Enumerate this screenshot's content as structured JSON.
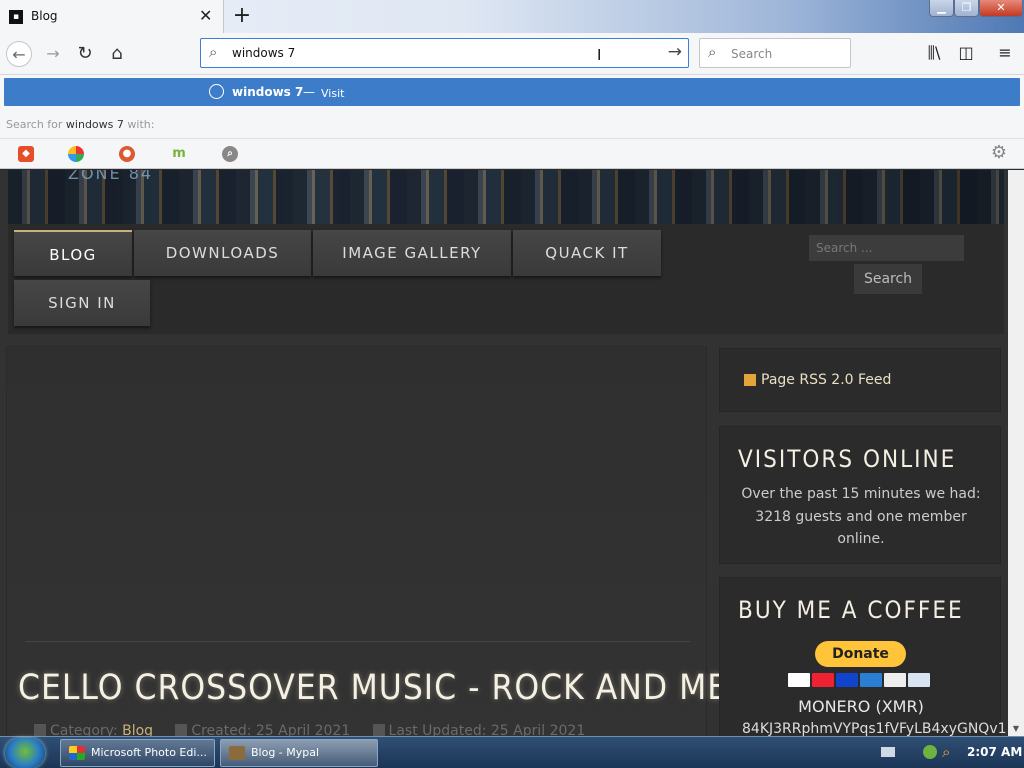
{
  "browser": {
    "tab": {
      "title": "Blog",
      "close_glyph": "✕"
    },
    "new_tab_glyph": "+",
    "window_controls": {
      "minimize": "▁",
      "maximize": "❐",
      "close": "✕"
    },
    "nav": {
      "back": "←",
      "forward": "→",
      "reload": "↻",
      "home": "⌂"
    },
    "urlbar": {
      "value": "windows 7",
      "search_icon": "⌕",
      "go_icon": "→",
      "caret": "I"
    },
    "searchbar": {
      "placeholder": "Search",
      "search_icon": "⌕"
    },
    "toolbar": {
      "library": "⫼\\",
      "sidebar": "◫",
      "menu": "≡"
    }
  },
  "urlbar_popup": {
    "suggestion": {
      "text": "windows 7",
      "dash": "—",
      "action": "Visit"
    },
    "search_for_prefix": "Search for ",
    "search_for_term": "windows 7",
    "search_for_suffix": " with:",
    "engines": [
      {
        "name": "brave-search-icon",
        "glyph": "◆"
      },
      {
        "name": "qwant-icon",
        "glyph": ""
      },
      {
        "name": "duckduckgo-icon",
        "glyph": "●"
      },
      {
        "name": "mojeek-icon",
        "glyph": "m"
      },
      {
        "name": "generic-search-icon",
        "glyph": "⌕"
      }
    ],
    "settings_glyph": "⚙"
  },
  "site": {
    "banner_logo": "ZONE 84",
    "menu": {
      "blog": "BLOG",
      "downloads": "DOWNLOADS",
      "gallery": "IMAGE GALLERY",
      "quack": "QUACK IT",
      "signin": "SIGN IN"
    },
    "search": {
      "placeholder": "Search ...",
      "button": "Search"
    },
    "article": {
      "title": "CELLO CROSSOVER MUSIC - ROCK AND METAL",
      "category_label": "Category: ",
      "category": "Blog",
      "created": "Created: 25 April 2021",
      "updated": "Last Updated: 25 April 2021"
    },
    "rss": {
      "label": "Page RSS 2.0 Feed"
    },
    "visitors": {
      "heading": "VISITORS ONLINE",
      "text": "Over the past 15 minutes we had: 3218 guests and one member online."
    },
    "coffee": {
      "heading": "BUY ME A COFFEE",
      "donate": "Donate",
      "xmr_label": "MONERO (XMR)",
      "xmr_address": "84KJ3RRphmVYPqs1fVFyLB4xyGNQv1"
    }
  },
  "taskbar": {
    "tasks": [
      "Microsoft Photo Edi...",
      "Blog - Mypal"
    ],
    "clock": "2:07 AM"
  },
  "colors": {
    "accent": "#3d7cc9",
    "site_gold": "#c9b27a",
    "donate_yellow": "#ffc439"
  }
}
